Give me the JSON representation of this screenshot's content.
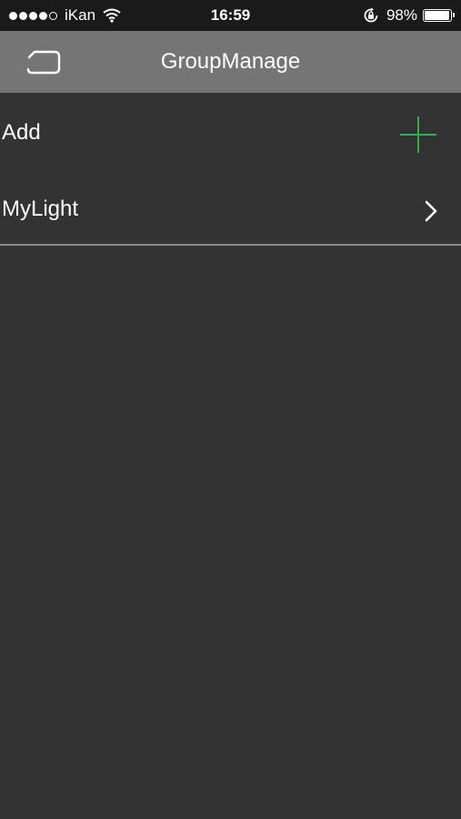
{
  "status_bar": {
    "carrier": "iKan",
    "time": "16:59",
    "battery_percent": "98%",
    "signal_bars_filled": 4,
    "signal_bars_total": 5
  },
  "nav": {
    "title": "GroupManage",
    "back_icon": "back-return-icon"
  },
  "list": {
    "items": [
      {
        "label": "Add",
        "accessory": "plus-icon"
      },
      {
        "label": "MyLight",
        "accessory": "chevron-right-icon"
      }
    ]
  },
  "colors": {
    "background": "#333333",
    "status_bar": "#1a1a1a",
    "nav_bar": "#757575",
    "accent_green": "#2bb24c",
    "divider": "#8a8a8a",
    "text": "#ffffff"
  }
}
